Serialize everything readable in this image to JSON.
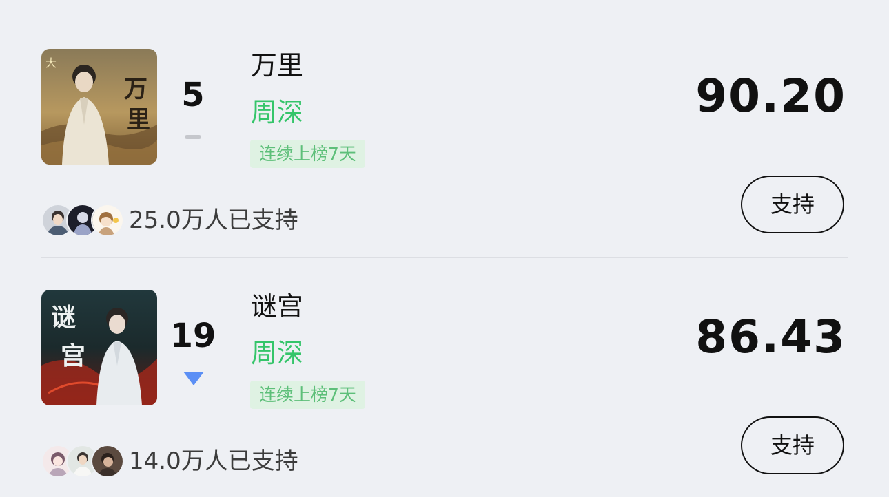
{
  "items": [
    {
      "rank": "5",
      "trend": "flat",
      "title": "万里",
      "artist": "周深",
      "streak": "连续上榜7天",
      "score": "90.20",
      "supporters": "25.0万人已支持",
      "support_label": "支持",
      "cover_icon": "album-cover",
      "cover_lettering": "万里",
      "cover_colors": [
        "#b89a63",
        "#6e5532",
        "#e9e3d3"
      ]
    },
    {
      "rank": "19",
      "trend": "down",
      "title": "谜宫",
      "artist": "周深",
      "streak": "连续上榜7天",
      "score": "86.43",
      "supporters": "14.0万人已支持",
      "support_label": "支持",
      "cover_icon": "album-cover",
      "cover_lettering": "谜宫",
      "cover_colors": [
        "#1f3a3f",
        "#9c2a1e",
        "#e8ecef"
      ]
    }
  ],
  "colors": {
    "background": "#eef0f4",
    "artist_green": "#35c56a",
    "streak_bg": "#dff2e3",
    "streak_text": "#5dbf79",
    "trend_down_blue": "#5b8ff5",
    "trend_flat_gray": "#c5c7cc"
  }
}
